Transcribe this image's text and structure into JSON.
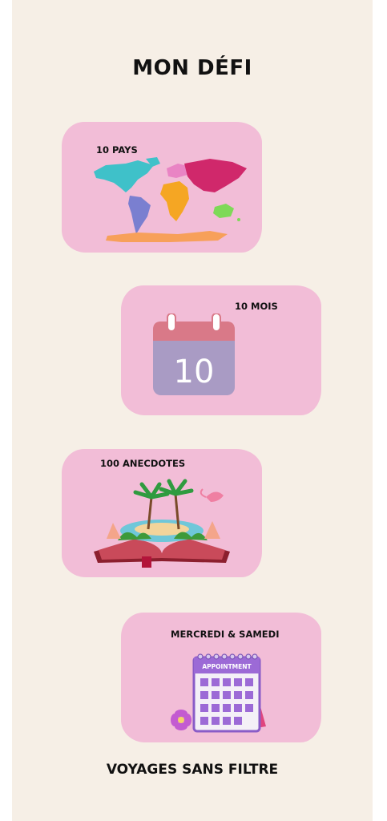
{
  "title": "MON DÉFI",
  "cards": [
    {
      "label": "10 PAYS",
      "icon": "world-map-icon"
    },
    {
      "label": "10 MOIS",
      "icon": "calendar-icon",
      "calendar_number": "10"
    },
    {
      "label": "100 ANECDOTES",
      "icon": "open-book-island-icon"
    },
    {
      "label": "MERCREDI & SAMEDI",
      "icon": "appointment-calendar-icon",
      "appointment_text": "APPOINTMENT"
    }
  ],
  "footer": "VOYAGES SANS FILTRE",
  "colors": {
    "background": "#f6efe6",
    "card": "#f2bdd7",
    "text": "#111111"
  }
}
